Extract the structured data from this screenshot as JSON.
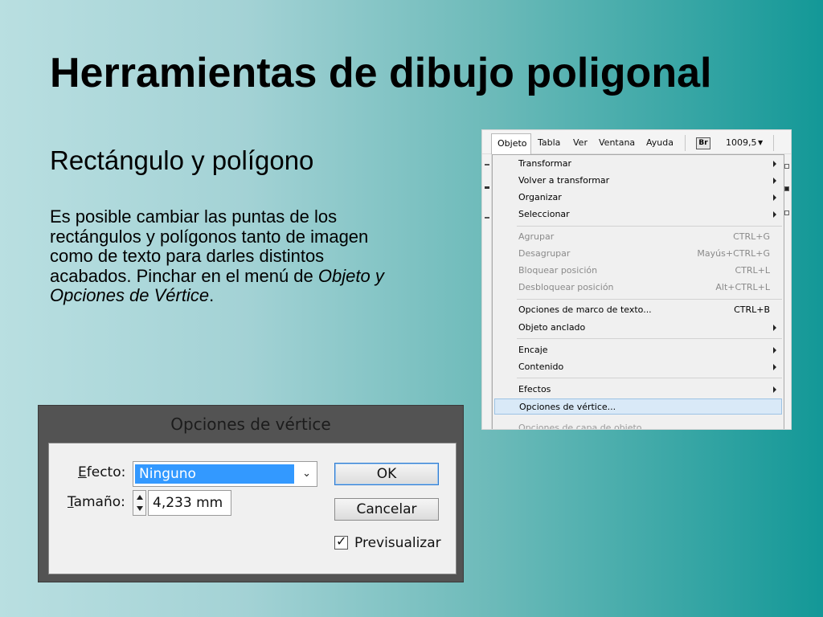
{
  "slide": {
    "title": "Herramientas de dibujo poligonal",
    "subtitle": "Rectángulo y polígono",
    "body_text": "Es posible cambiar las puntas de los rectángulos y polígonos tanto de imagen como de texto para darles distintos acabados. Pinchar en el menú de ",
    "body_emphasis": "Objeto y Opciones de Vértice",
    "body_end": "."
  },
  "menubar": {
    "items": [
      "Objeto",
      "Tabla",
      "Ver",
      "Ventana",
      "Ayuda"
    ],
    "bridge_badge": "Br",
    "zoom": "1009,5"
  },
  "menu": {
    "items": [
      {
        "label": "Transformar",
        "submenu": true
      },
      {
        "label": "Volver a transformar",
        "submenu": true
      },
      {
        "label": "Organizar",
        "submenu": true
      },
      {
        "label": "Seleccionar",
        "submenu": true
      },
      {
        "label": "Agrupar",
        "shortcut": "CTRL+G",
        "disabled": true
      },
      {
        "label": "Desagrupar",
        "shortcut": "Mayús+CTRL+G",
        "disabled": true
      },
      {
        "label": "Bloquear posición",
        "shortcut": "CTRL+L",
        "disabled": true
      },
      {
        "label": "Desbloquear posición",
        "shortcut": "Alt+CTRL+L",
        "disabled": true
      },
      {
        "label": "Opciones de marco de texto...",
        "shortcut": "CTRL+B"
      },
      {
        "label": "Objeto anclado",
        "submenu": true
      },
      {
        "label": "Encaje",
        "submenu": true
      },
      {
        "label": "Contenido",
        "submenu": true
      },
      {
        "label": "Efectos",
        "submenu": true
      },
      {
        "label": "Opciones de vértice...",
        "highlighted": true
      },
      {
        "label": "Opciones de capa de objeto...",
        "partial": true
      }
    ]
  },
  "dialog": {
    "title": "Opciones de vértice",
    "efecto_label": "Efecto:",
    "efecto_value": "Ninguno",
    "tamano_label": "Tamaño:",
    "tamano_value": "4,233 mm",
    "ok_label": "OK",
    "cancel_label": "Cancelar",
    "preview_label": "Previsualizar",
    "preview_checked": true
  }
}
